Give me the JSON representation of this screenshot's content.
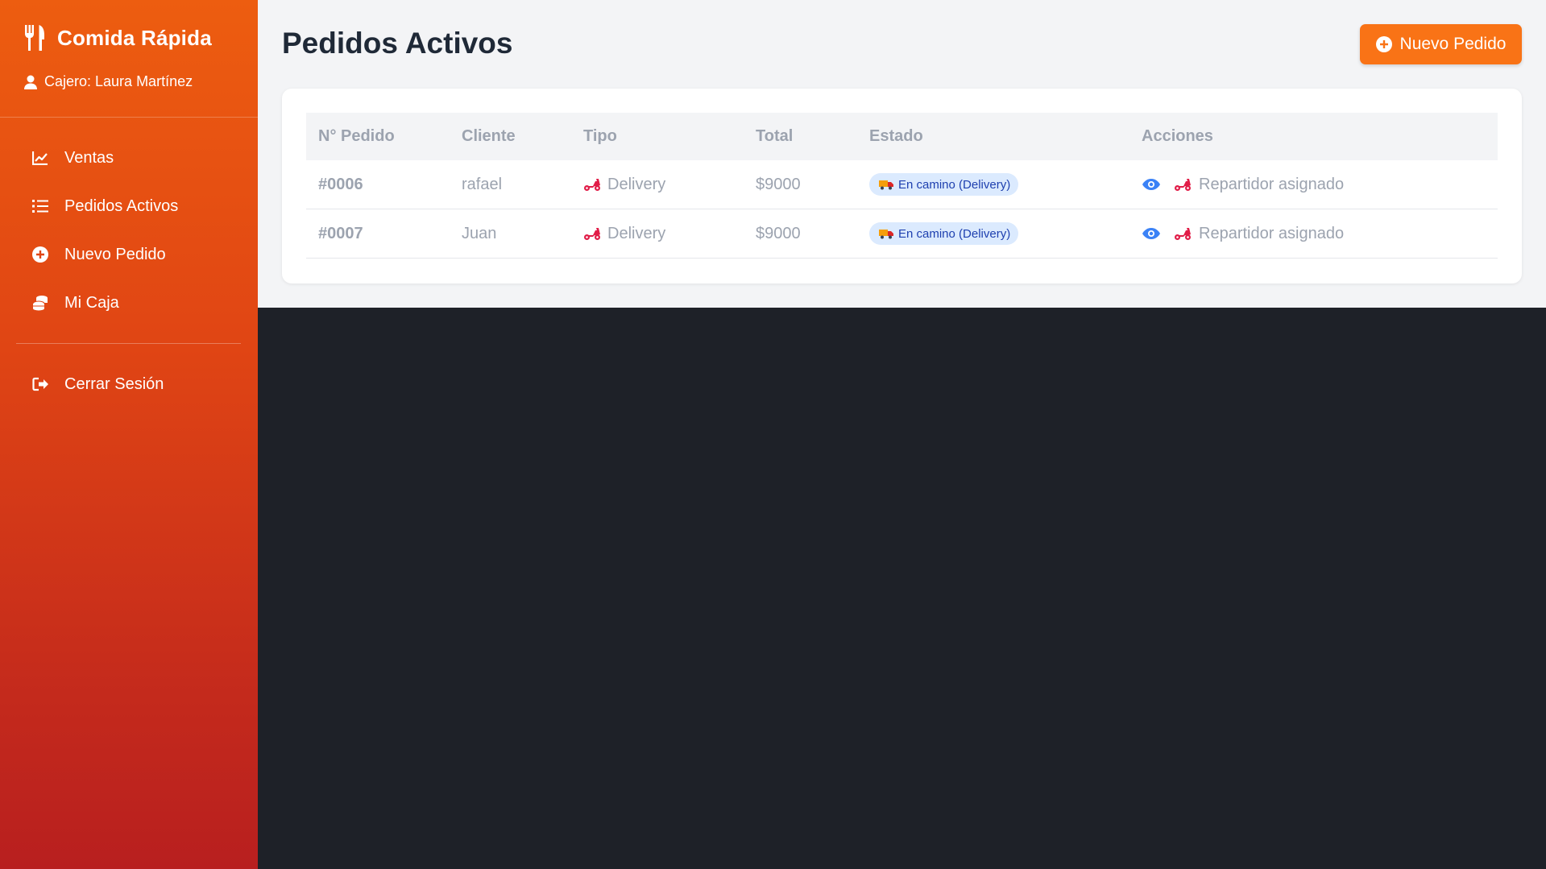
{
  "sidebar": {
    "brand_title": "Comida Rápida",
    "cashier_label": "Cajero: Laura Martínez",
    "items": [
      {
        "label": "Ventas",
        "icon": "chart-line-icon"
      },
      {
        "label": "Pedidos Activos",
        "icon": "list-icon"
      },
      {
        "label": "Nuevo Pedido",
        "icon": "plus-circle-icon"
      },
      {
        "label": "Mi Caja",
        "icon": "coins-icon"
      }
    ],
    "logout_label": "Cerrar Sesión"
  },
  "main": {
    "title": "Pedidos Activos",
    "new_order_label": "Nuevo Pedido",
    "table": {
      "headers": [
        "N° Pedido",
        "Cliente",
        "Tipo",
        "Total",
        "Estado",
        "Acciones"
      ],
      "rows": [
        {
          "id": "#0006",
          "client": "rafael",
          "type": "Delivery",
          "total": "$9000",
          "status": "En camino (Delivery)",
          "action": "Repartidor asignado"
        },
        {
          "id": "#0007",
          "client": "Juan",
          "type": "Delivery",
          "total": "$9000",
          "status": "En camino (Delivery)",
          "action": "Repartidor asignado"
        }
      ]
    }
  },
  "colors": {
    "accent": "#f97316",
    "sidebar_top": "#ed5d10",
    "sidebar_bottom": "#b81f1f",
    "badge_bg": "#dbeafe",
    "badge_text": "#1e40af",
    "eye_icon": "#3b82f6",
    "scooter_icon": "#e11d48"
  }
}
